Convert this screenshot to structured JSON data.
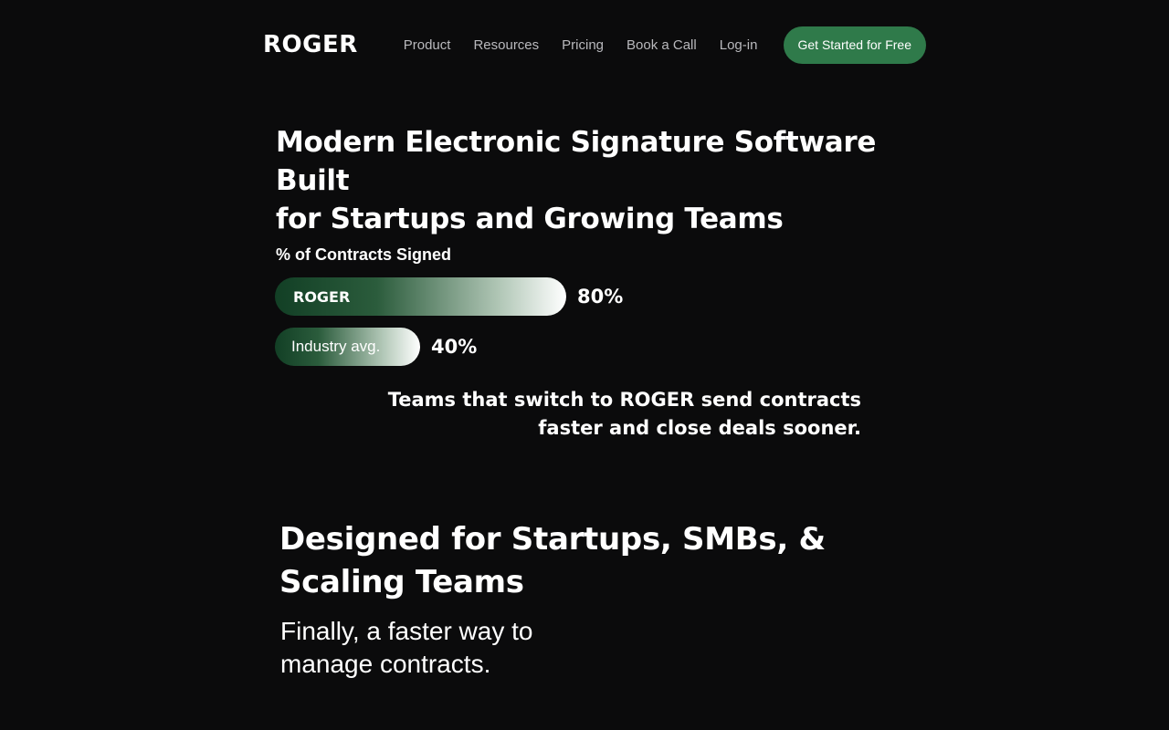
{
  "nav": {
    "logo": "ROGER",
    "links": [
      "Product",
      "Resources",
      "Pricing",
      "Book a Call",
      "Log-in"
    ],
    "cta_label": "Get Started for Free"
  },
  "hero": {
    "title_line1": "Modern Electronic Signature Software Built",
    "title_line2": "for Startups and Growing Teams"
  },
  "stats": {
    "label": "% of Contracts Signed",
    "bars": [
      {
        "name": "ROGER",
        "value_label": "80%",
        "value": 80
      },
      {
        "name": "Industry avg.",
        "value_label": "40%",
        "value": 40
      }
    ],
    "tagline_line1": "Teams that switch to ROGER send contracts",
    "tagline_line2": "faster and close deals sooner."
  },
  "section": {
    "title_line1": "Designed for Startups, SMBs, &",
    "title_line2": "Scaling Teams",
    "subtitle_line1": "Finally, a faster way to",
    "subtitle_line2": "manage contracts."
  },
  "colors": {
    "background": "#0b0b0c",
    "cta": "#2f7a4a",
    "bar_dark": "#123f25",
    "nav_link": "#b9b9bd"
  }
}
